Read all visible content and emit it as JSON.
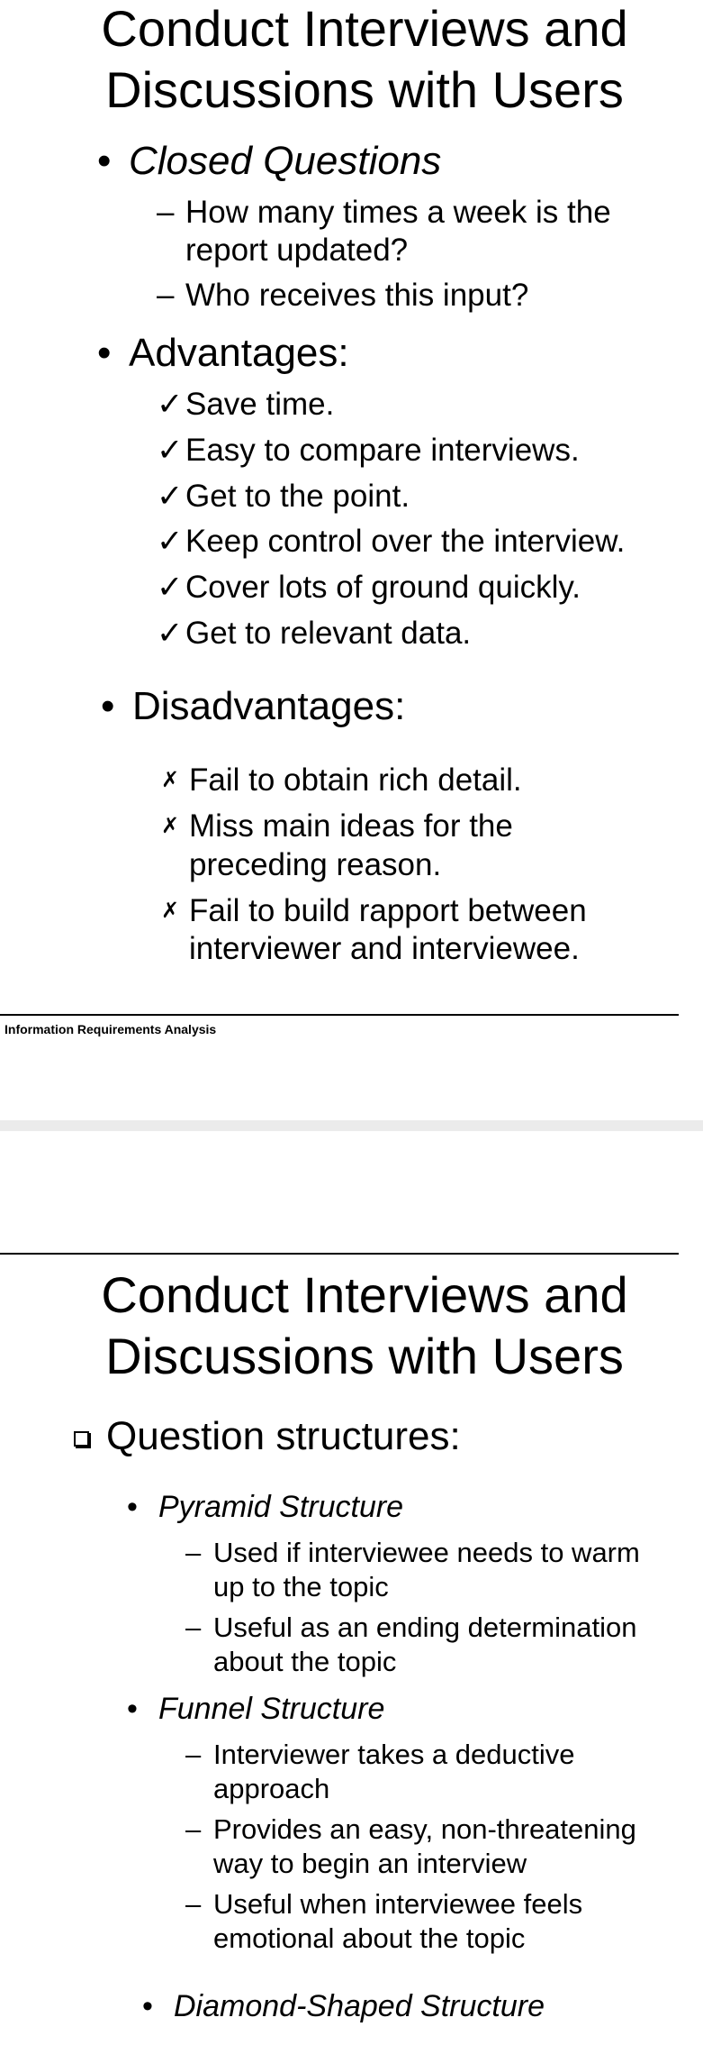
{
  "slide1": {
    "title_line1": "Conduct Interviews and",
    "title_line2": "Discussions with Users",
    "closed_questions": {
      "heading": "Closed Questions",
      "items": [
        {
          "line1": "How many times a week is the",
          "line2": "report updated?"
        },
        {
          "line1": "Who receives this input?"
        }
      ]
    },
    "advantages": {
      "heading": "Advantages:",
      "items": [
        "Save time.",
        "Easy to compare interviews.",
        "Get to the point.",
        "Keep control over the interview.",
        "Cover lots of ground quickly.",
        "Get to relevant data."
      ]
    },
    "disadvantages": {
      "heading": "Disadvantages:",
      "items": [
        {
          "line1": "Fail to obtain rich detail."
        },
        {
          "line1": "Miss main ideas for the",
          "line2": "preceding reason."
        },
        {
          "line1": "Fail to build rapport between",
          "line2": "interviewer and interviewee."
        }
      ]
    },
    "footer": "Information Requirements Analysis"
  },
  "slide2": {
    "title_line1": "Conduct Interviews and",
    "title_line2": "Discussions with Users",
    "section_heading": "Question structures:",
    "pyramid": {
      "heading": "Pyramid Structure",
      "items": [
        {
          "line1": "Used if interviewee needs to warm",
          "line2": "up to the topic"
        },
        {
          "line1": "Useful as an ending determination",
          "line2": "about the topic"
        }
      ]
    },
    "funnel": {
      "heading": "Funnel Structure",
      "items": [
        {
          "line1": "Interviewer takes a deductive",
          "line2": "approach"
        },
        {
          "line1": "Provides an easy, non-threatening",
          "line2": "way to begin an interview"
        },
        {
          "line1": "Useful when interviewee feels",
          "line2": "emotional about the topic"
        }
      ]
    },
    "diamond": {
      "heading": "Diamond-Shaped Structure"
    }
  },
  "glyphs": {
    "bullet": "•",
    "dash": "–",
    "check": "✓",
    "cross": "✗"
  },
  "colors": {
    "text": "#000000",
    "background": "#ffffff",
    "page_gap": "#ebebeb"
  }
}
